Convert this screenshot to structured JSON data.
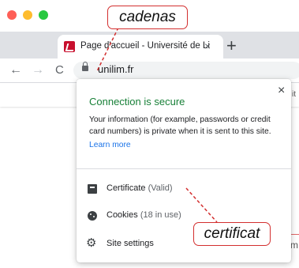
{
  "browser": {
    "tab": {
      "title": "Page d'accueil - Université de Li",
      "close_glyph": "×"
    },
    "new_tab_glyph": "+",
    "nav": {
      "back": "←",
      "forward": "→",
      "reload": "C"
    },
    "url": "unilim.fr"
  },
  "popup": {
    "close_glyph": "×",
    "title": "Connection is secure",
    "description": "Your information (for example, passwords or credit card numbers) is private when it is sent to this site.",
    "learn_more": "Learn more",
    "items": [
      {
        "label": "Certificate",
        "meta": "(Valid)",
        "icon": "certificate-icon"
      },
      {
        "label": "Cookies",
        "meta": "(18 in use)",
        "icon": "cookie-icon"
      },
      {
        "label": "Site settings",
        "meta": "",
        "icon": "gear-icon"
      }
    ]
  },
  "annotations": {
    "lock_callout": "cadenas",
    "certificate_callout": "certificat"
  },
  "page_edge": {
    "text_top": "it",
    "text_bottom": "m"
  },
  "colors": {
    "secure_green": "#188038",
    "link_blue": "#1a73e8",
    "annotation_red": "#d32f2f"
  }
}
